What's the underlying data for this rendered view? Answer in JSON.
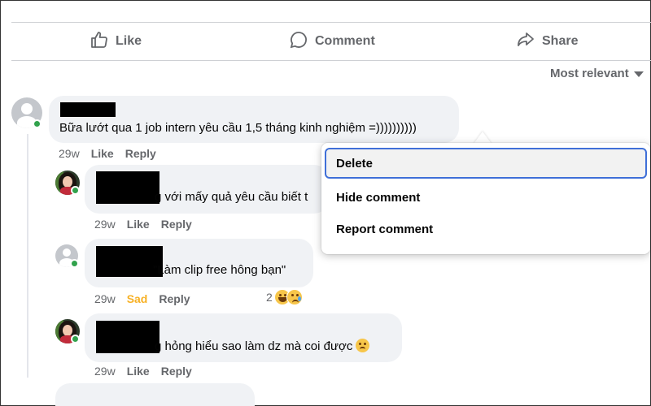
{
  "actions": {
    "like": "Like",
    "comment": "Comment",
    "share": "Share"
  },
  "sort": {
    "label": "Most relevant"
  },
  "comments": [
    {
      "text": "Bữa lướt qua 1 job intern yêu cầu 1,5 tháng kinh nghiệm =))))))))))",
      "time": "29w",
      "like": "Like",
      "reply": "Reply"
    },
    {
      "text": "g với mấy quả yêu cầu biết t",
      "time": "29w",
      "like": "Like",
      "reply": "Reply"
    },
    {
      "text": "\"Làm clip free hông bạn\"",
      "time": "29w",
      "like": "Sad",
      "reply": "Reply",
      "reaction_count": "2"
    },
    {
      "text": "g hỏng hiểu sao làm dz mà coi được",
      "time": "29w",
      "like": "Like",
      "reply": "Reply"
    }
  ],
  "menu": {
    "items": [
      "Delete",
      "Hide comment",
      "Report comment"
    ],
    "active": "Delete"
  },
  "colors": {
    "online": "#31a24c",
    "sad": "#f7b125",
    "focus": "#3f6fd8",
    "bubble": "#f0f2f5"
  }
}
